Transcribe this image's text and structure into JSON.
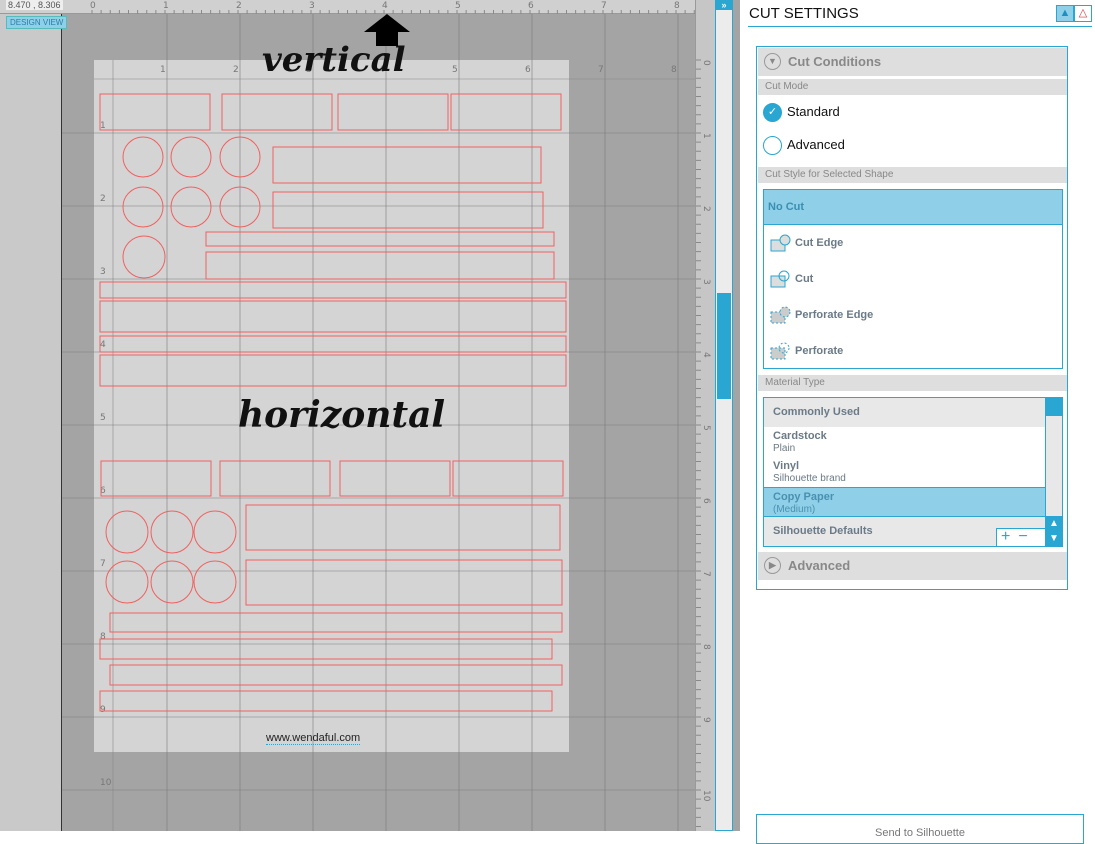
{
  "canvas": {
    "coordinates": "8.470 , 8.306",
    "design_view_label": "DESIGN VIEW",
    "top_ruler_labels": [
      "0",
      "1",
      "2",
      "3",
      "4",
      "5",
      "6",
      "7",
      "8"
    ],
    "side_ruler_labels": [
      "0",
      "1",
      "2",
      "3",
      "4",
      "5",
      "6",
      "7",
      "8",
      "9",
      "10"
    ],
    "page_col_labels": [
      "1",
      "2",
      "3",
      "4",
      "5",
      "6",
      "7",
      "8"
    ],
    "page_row_labels": [
      "1",
      "2",
      "3",
      "4",
      "5",
      "6",
      "7",
      "8",
      "9",
      "10"
    ],
    "text_vertical": "vertical",
    "text_horizontal": "horizontal",
    "watermark": "www.wendaful.com",
    "cut_line_color": "#f06060",
    "expand_icon": "double-chevron-right-icon"
  },
  "panel": {
    "title": "CUT SETTINGS",
    "cut_conditions": "Cut Conditions",
    "cut_mode_label": "Cut Mode",
    "modes": [
      {
        "label": "Standard",
        "selected": true
      },
      {
        "label": "Advanced",
        "selected": false
      }
    ],
    "cut_style_label": "Cut Style for Selected Shape",
    "styles": [
      "No Cut",
      "Cut Edge",
      "Cut",
      "Perforate Edge",
      "Perforate"
    ],
    "selected_style": "No Cut",
    "material_type_label": "Material Type",
    "materials": {
      "group1": "Commonly Used",
      "items": [
        {
          "name": "Cardstock",
          "detail": "Plain"
        },
        {
          "name": "Vinyl",
          "detail": "Silhouette brand"
        },
        {
          "name": "Copy Paper",
          "detail": "(Medium)",
          "selected": true
        }
      ],
      "group2": "Silhouette Defaults"
    },
    "plus": "+",
    "minus": "−",
    "advanced": "Advanced",
    "send_button": "Send to Silhouette",
    "accent_color": "#29a6d1"
  }
}
